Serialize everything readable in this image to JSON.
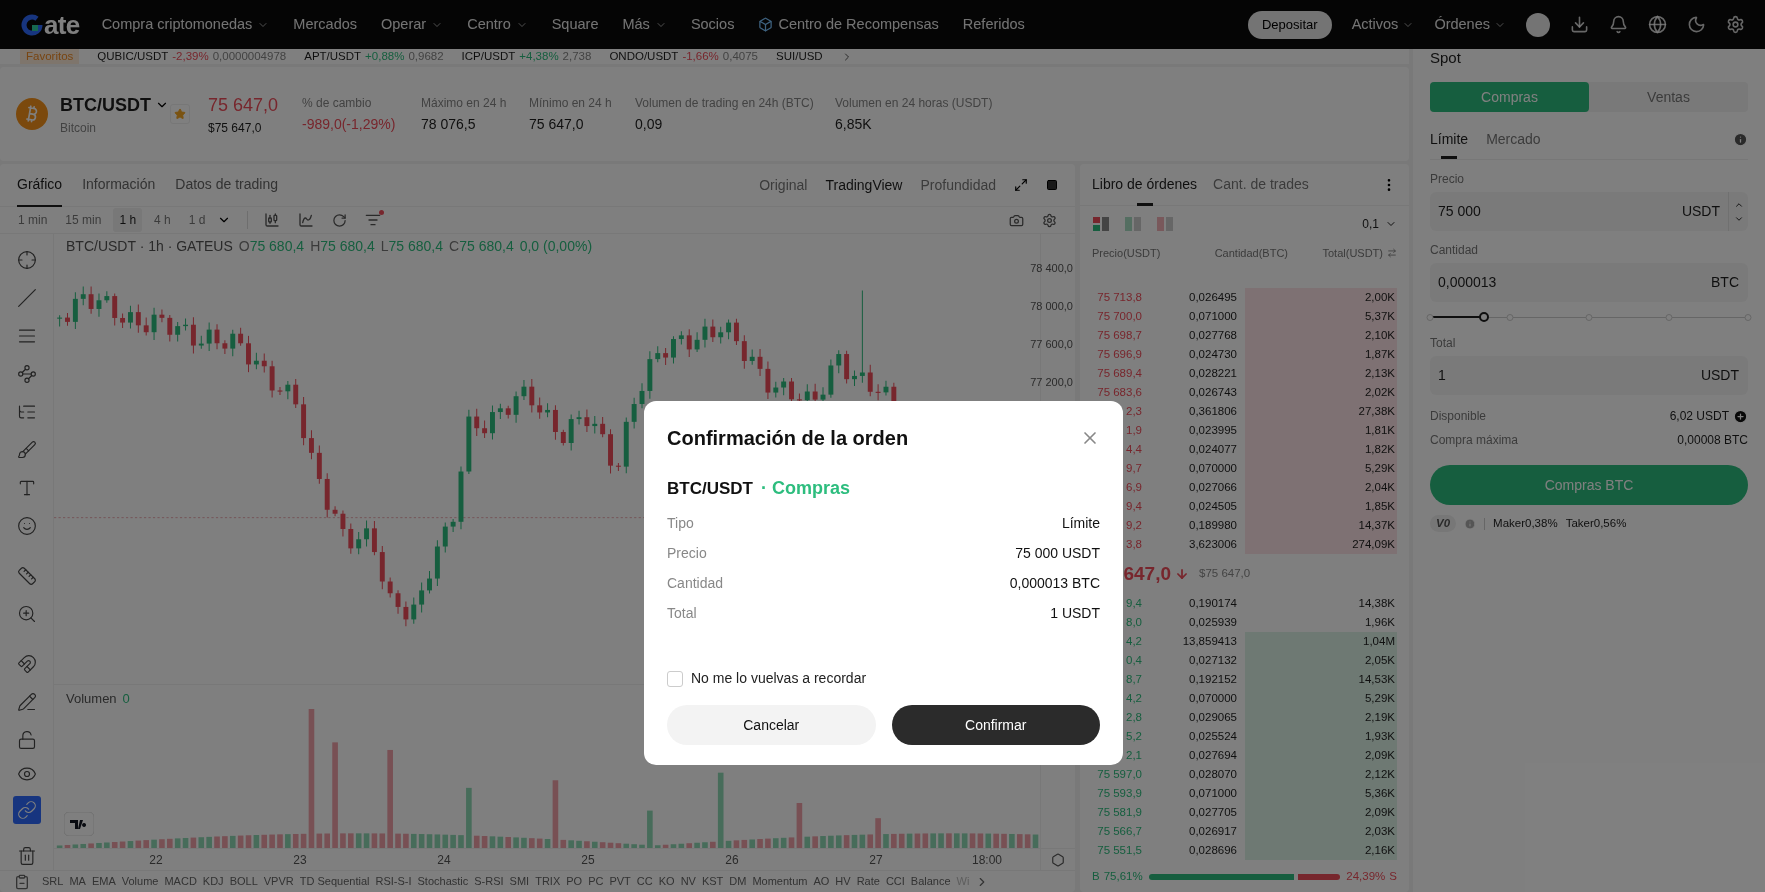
{
  "nav": {
    "logo_text": "ate",
    "items": [
      {
        "label": "Compra criptomonedas",
        "dropdown": true,
        "icon": false
      },
      {
        "label": "Mercados",
        "dropdown": false,
        "icon": false
      },
      {
        "label": "Operar",
        "dropdown": true,
        "icon": false
      },
      {
        "label": "Centro",
        "dropdown": true,
        "icon": false
      },
      {
        "label": "Square",
        "dropdown": false,
        "icon": false
      },
      {
        "label": "Más",
        "dropdown": true,
        "icon": false
      },
      {
        "label": "Socios",
        "dropdown": false,
        "icon": false
      },
      {
        "label": "Centro de Recompensas",
        "dropdown": false,
        "icon": true
      },
      {
        "label": "Referidos",
        "dropdown": false,
        "icon": false
      }
    ],
    "deposit": "Depositar",
    "menus": [
      "Activos",
      "Órdenes"
    ]
  },
  "ticker": {
    "favorites": "Favoritos",
    "items": [
      {
        "pair": "QUBIC/USDT",
        "change": "-2,39%",
        "price": "0,0000004978",
        "negative": true
      },
      {
        "pair": "APT/USDT",
        "change": "+0,88%",
        "price": "0,9682",
        "negative": false
      },
      {
        "pair": "ICP/USDT",
        "change": "+4,38%",
        "price": "2,738",
        "negative": false
      },
      {
        "pair": "ONDO/USDT",
        "change": "-1,66%",
        "price": "0,4075",
        "negative": true
      },
      {
        "pair": "SUI/USD"
      }
    ]
  },
  "pair": {
    "symbol": "BTC/USDT",
    "name": "Bitcoin",
    "favorite": true,
    "price": "75 647,0",
    "price_fiat": "$75 647,0",
    "stats": [
      {
        "label": "% de cambio",
        "value": "-989,0(-1,29%)",
        "negative": true
      },
      {
        "label": "Máximo en 24 h",
        "value": "78 076,5",
        "negative": false
      },
      {
        "label": "Mínimo en 24 h",
        "value": "75 647,0",
        "negative": false
      },
      {
        "label": "Volumen de trading en 24h (BTC)",
        "value": "0,09",
        "negative": false
      },
      {
        "label": "Volumen en 24 horas (USDT)",
        "value": "6,85K",
        "negative": false
      }
    ]
  },
  "chart_panel": {
    "tabs": [
      {
        "label": "Gráfico",
        "selected": true
      },
      {
        "label": "Información",
        "selected": false
      },
      {
        "label": "Datos de trading",
        "selected": false
      }
    ],
    "views": [
      {
        "label": "Original",
        "selected": false
      },
      {
        "label": "TradingView",
        "selected": true
      },
      {
        "label": "Profundidad",
        "selected": false
      }
    ],
    "intervals": [
      {
        "label": "1 min",
        "selected": false
      },
      {
        "label": "15 min",
        "selected": false
      },
      {
        "label": "1 h",
        "selected": true
      },
      {
        "label": "4 h",
        "selected": false
      },
      {
        "label": "1 d",
        "selected": false
      }
    ],
    "drawing_tools": [
      {
        "selected": false
      },
      {
        "selected": false
      },
      {
        "selected": false
      },
      {
        "selected": false
      },
      {
        "selected": false
      },
      {
        "selected": false
      },
      {
        "selected": false
      },
      {
        "selected": false
      },
      {
        "selected": false
      },
      {
        "selected": false
      },
      {
        "selected": false
      },
      {
        "selected": false
      },
      {
        "selected": false
      },
      {
        "selected": false
      },
      {
        "selected": true
      },
      {
        "selected": false
      }
    ],
    "legend": {
      "title": "BTC/USDT · 1h · GATEUS",
      "ohlc": [
        {
          "key": "O",
          "value": "75 680,4"
        },
        {
          "key": "H",
          "value": "75 680,4"
        },
        {
          "key": "L",
          "value": "75 680,4"
        },
        {
          "key": "C",
          "value": "75 680,4"
        }
      ],
      "change": "0,0 (0,00%)"
    },
    "price_axis": [
      "78 400,0",
      "78 000,0",
      "77 600,0",
      "77 200,0"
    ],
    "volume": {
      "label": "Volumen",
      "value": "0"
    },
    "time_axis": [
      "22",
      "23",
      "24",
      "25",
      "26",
      "27",
      "18:00"
    ],
    "indicators": [
      "SRL",
      "MA",
      "EMA",
      "Volume",
      "MACD",
      "KDJ",
      "BOLL",
      "VPVR",
      "TD Sequential",
      "RSI-S-I",
      "Stochastic",
      "S-RSI",
      "SMI",
      "TRIX",
      "PO",
      "PC",
      "PVT",
      "CC",
      "KO",
      "NV",
      "KST",
      "DM",
      "Momentum",
      "AO",
      "HV",
      "Rate",
      "CCI",
      "Balance",
      "Wi"
    ]
  },
  "order_book": {
    "tabs": [
      {
        "label": "Libro de órdenes",
        "selected": true
      },
      {
        "label": "Cant. de trades",
        "selected": false
      }
    ],
    "precision": "0,1",
    "columns": [
      "Precio(USDT)",
      "Cantidad(BTC)",
      "Total(USDT)"
    ],
    "asks": [
      {
        "price": "75 713,8",
        "amount": "0,026495",
        "total": "2,00K",
        "depth_bar": true
      },
      {
        "price": "75 700,0",
        "amount": "0,071000",
        "total": "5,37K",
        "depth_bar": true
      },
      {
        "price": "75 698,7",
        "amount": "0,027768",
        "total": "2,10K",
        "depth_bar": true
      },
      {
        "price": "75 696,9",
        "amount": "0,024730",
        "total": "1,87K",
        "depth_bar": true
      },
      {
        "price": "75 689,4",
        "amount": "0,028221",
        "total": "2,13K",
        "depth_bar": true
      },
      {
        "price": "75 683,6",
        "amount": "0,026743",
        "total": "2,02K",
        "depth_bar": true
      },
      {
        "price": "2,3",
        "amount": "0,361806",
        "total": "27,38K",
        "depth_bar": true
      },
      {
        "price": "1,9",
        "amount": "0,023995",
        "total": "1,81K",
        "depth_bar": true
      },
      {
        "price": "4,4",
        "amount": "0,024077",
        "total": "1,82K",
        "depth_bar": true
      },
      {
        "price": "9,7",
        "amount": "0,070000",
        "total": "5,29K",
        "depth_bar": true
      },
      {
        "price": "6,9",
        "amount": "0,027066",
        "total": "2,04K",
        "depth_bar": true
      },
      {
        "price": "9,4",
        "amount": "0,024505",
        "total": "1,85K",
        "depth_bar": true
      },
      {
        "price": "9,2",
        "amount": "0,189980",
        "total": "14,37K",
        "depth_bar": true
      },
      {
        "price": "3,8",
        "amount": "3,623006",
        "total": "274,09K",
        "depth_bar": true
      }
    ],
    "mid": {
      "price": "647,0",
      "fiat": "$75 647,0"
    },
    "bids": [
      {
        "price": "9,4",
        "amount": "0,190174",
        "total": "14,38K",
        "depth_bar": false
      },
      {
        "price": "8,0",
        "amount": "0,025939",
        "total": "1,96K",
        "depth_bar": false
      },
      {
        "price": "4,2",
        "amount": "13,859413",
        "total": "1,04M",
        "depth_bar": true
      },
      {
        "price": "0,4",
        "amount": "0,027132",
        "total": "2,05K",
        "depth_bar": true
      },
      {
        "price": "8,7",
        "amount": "0,192152",
        "total": "14,53K",
        "depth_bar": true
      },
      {
        "price": "4,2",
        "amount": "0,070000",
        "total": "5,29K",
        "depth_bar": true
      },
      {
        "price": "2,8",
        "amount": "0,029065",
        "total": "2,19K",
        "depth_bar": true
      },
      {
        "price": "5,2",
        "amount": "0,025524",
        "total": "1,93K",
        "depth_bar": true
      },
      {
        "price": "2,1",
        "amount": "0,027694",
        "total": "2,09K",
        "depth_bar": true
      },
      {
        "price": "75 597,0",
        "amount": "0,028070",
        "total": "2,12K",
        "depth_bar": true
      },
      {
        "price": "75 593,9",
        "amount": "0,071000",
        "total": "5,36K",
        "depth_bar": true
      },
      {
        "price": "75 581,9",
        "amount": "0,027705",
        "total": "2,09K",
        "depth_bar": true
      },
      {
        "price": "75 566,7",
        "amount": "0,026917",
        "total": "2,03K",
        "depth_bar": true
      },
      {
        "price": "75 551,5",
        "amount": "0,028696",
        "total": "2,16K",
        "depth_bar": true
      }
    ],
    "ratio": {
      "buy_label": "B",
      "buy": "75,61%",
      "sell": "24,39%",
      "sell_label": "S",
      "level": 0.7561
    }
  },
  "order_form": {
    "title": "Spot",
    "sides": [
      {
        "label": "Compras",
        "selected": true
      },
      {
        "label": "Ventas",
        "selected": false
      }
    ],
    "types": [
      {
        "label": "Límite",
        "selected": true
      },
      {
        "label": "Mercado",
        "selected": false
      }
    ],
    "rows": [
      {
        "kind": "field",
        "label": "Precio",
        "value": "75 000",
        "unit": "USDT",
        "stepper": true
      },
      {
        "kind": "field",
        "label": "Cantidad",
        "value": "0,000013",
        "unit": "BTC",
        "stepper": false
      },
      {
        "kind": "slider",
        "level": 0.17
      },
      {
        "kind": "field",
        "label": "Total",
        "value": "1",
        "unit": "USDT",
        "stepper": false
      }
    ],
    "info": [
      {
        "label": "Disponible",
        "value": "6,02 USDT",
        "add": true
      },
      {
        "label": "Compra máxima",
        "value": "0,00008 BTC",
        "add": false
      }
    ],
    "submit": "Compras BTC",
    "fees": {
      "tier": "V0",
      "maker": "Maker0,38%",
      "taker": "Taker0,56%"
    }
  },
  "modal": {
    "title": "Confirmación de la orden",
    "pair": "BTC/USDT",
    "side": "· Compras",
    "rows": [
      {
        "label": "Tipo",
        "value": "Límite"
      },
      {
        "label": "Precio",
        "value": "75 000 USDT"
      },
      {
        "label": "Cantidad",
        "value": "0,000013 BTC"
      },
      {
        "label": "Total",
        "value": "1 USDT"
      }
    ],
    "checkbox": {
      "label": "No me lo vuelvas a recordar",
      "checked": false
    },
    "buttons": [
      {
        "label": "Cancelar",
        "kind": "secondary"
      },
      {
        "label": "Confirmar",
        "kind": "primary"
      }
    ]
  }
}
